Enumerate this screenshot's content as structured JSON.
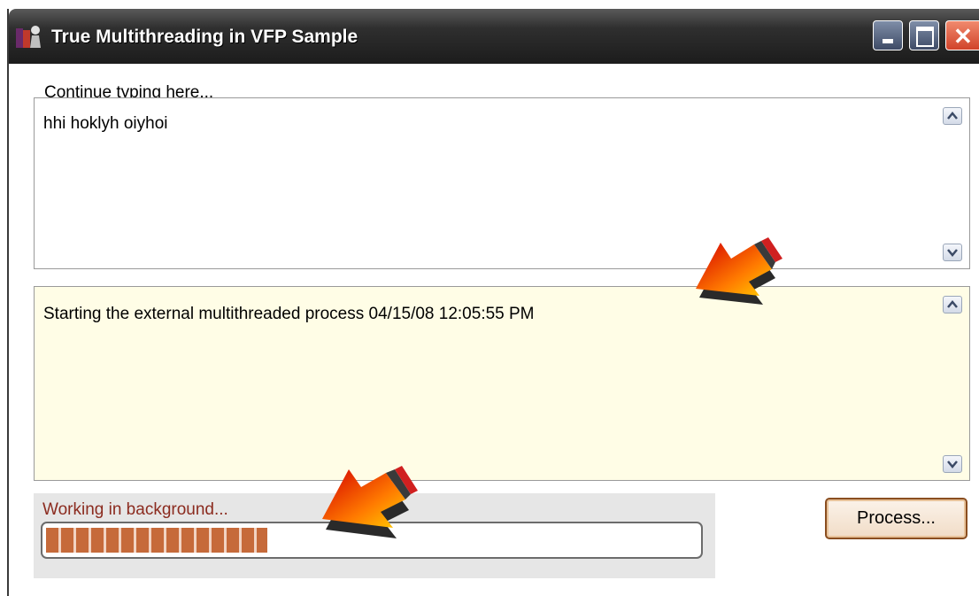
{
  "window": {
    "title": "True Multithreading in VFP Sample",
    "title_icon": "app-icon",
    "controls": [
      "minimize-icon",
      "maximize-icon",
      "close-icon"
    ]
  },
  "input_section": {
    "label": "Continue typing here...",
    "value": "hhi hoklyh oiyhoi"
  },
  "log_section": {
    "value": "Starting the external multithreaded process 04/15/08 12:05:55 PM"
  },
  "status": {
    "text": "Working in background...",
    "progress": 0.34
  },
  "buttons": {
    "process_label": "Process..."
  },
  "colors": {
    "titlebar": "#2f2f2f",
    "log_background": "#fffde6",
    "status_text": "#8b2b1f",
    "progress_fill": "#c66a3a"
  },
  "annotations": [
    "arrow-callout-icon",
    "arrow-callout-icon"
  ]
}
